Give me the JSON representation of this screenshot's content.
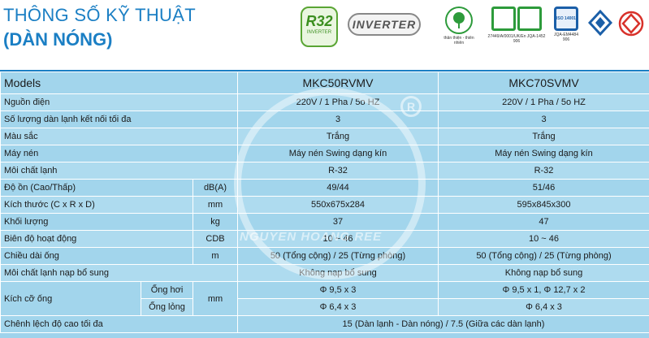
{
  "header": {
    "title_line1": "THÔNG SỐ KỸ THUẬT",
    "title_line2": "(DÀN NÓNG)",
    "logo_r32": "R32",
    "logo_r32_sub": "INVERTER",
    "logo_inverter": "INVERTER",
    "logo_eco_caption": "thân thiện - thiên nhiên",
    "logo_cert1_caption": "27449/A/0001/UK/En JQA-1452 906",
    "logo_cert2_caption": "JQA-EM4484 906",
    "logo_iso": "ISO 14001"
  },
  "table": {
    "columns": [
      "Models",
      "MKC50RVMV",
      "MKC70SVMV"
    ],
    "rows": [
      {
        "label": "Nguồn điện",
        "unit": "",
        "v1": "220V / 1 Pha / 5o HZ",
        "v2": "220V / 1 Pha / 5o HZ"
      },
      {
        "label": "Số lượng dàn lạnh kết nối tối đa",
        "unit": "",
        "v1": "3",
        "v2": "3"
      },
      {
        "label": "Màu sắc",
        "unit": "",
        "v1": "Trắng",
        "v2": "Trắng"
      },
      {
        "label": "Máy nén",
        "unit": "",
        "v1": "Máy nén Swing dạng kín",
        "v2": "Máy nén Swing dạng kín"
      },
      {
        "label": "Môi chất lạnh",
        "unit": "",
        "v1": "R-32",
        "v2": "R-32"
      },
      {
        "label": "Độ ồn (Cao/Thấp)",
        "unit": "dB(A)",
        "v1": "49/44",
        "v2": "51/46"
      },
      {
        "label": "Kích thước (C x R x D)",
        "unit": "mm",
        "v1": "550x675x284",
        "v2": "595x845x300"
      },
      {
        "label": "Khối lượng",
        "unit": "kg",
        "v1": "37",
        "v2": "47"
      },
      {
        "label": "Biên độ hoạt động",
        "unit": "CDB",
        "v1": "10 ~ 46",
        "v2": "10 ~ 46"
      },
      {
        "label": "Chiều dài ống",
        "unit": "m",
        "v1": "50 (Tổng cộng) / 25 (Từng phòng)",
        "v2": "50 (Tổng cộng) / 25 (Từng phòng)"
      },
      {
        "label": "Môi chất lạnh nạp bổ sung",
        "unit": "",
        "v1": "Không nạp bổ sung",
        "v2": "Không nạp bổ sung"
      }
    ],
    "pipe": {
      "label": "Kích cỡ ống",
      "unit": "mm",
      "sub1": "Ống hơi",
      "sub2": "Ống lỏng",
      "gas_v1": "Φ 9,5 x 3",
      "gas_v2": "Φ 9,5 x 1,  Φ 12,7 x 2",
      "liquid_v1": "Φ 6,4 x 3",
      "liquid_v2": "Φ 6,4 x 3"
    },
    "height_diff": {
      "label": "Chênh lệch độ cao tối đa",
      "value": "15 (Dàn lạnh - Dàn nóng) / 7.5 (Giữa các dàn lạnh)"
    }
  },
  "watermark": {
    "text": "NGUYEN HOANG REE",
    "reg": "R"
  },
  "colors": {
    "title": "#1b7fc4",
    "table_bg": "#a2d5ec",
    "eco_green": "#2d9b3b",
    "cert_red": "#d8312a"
  }
}
